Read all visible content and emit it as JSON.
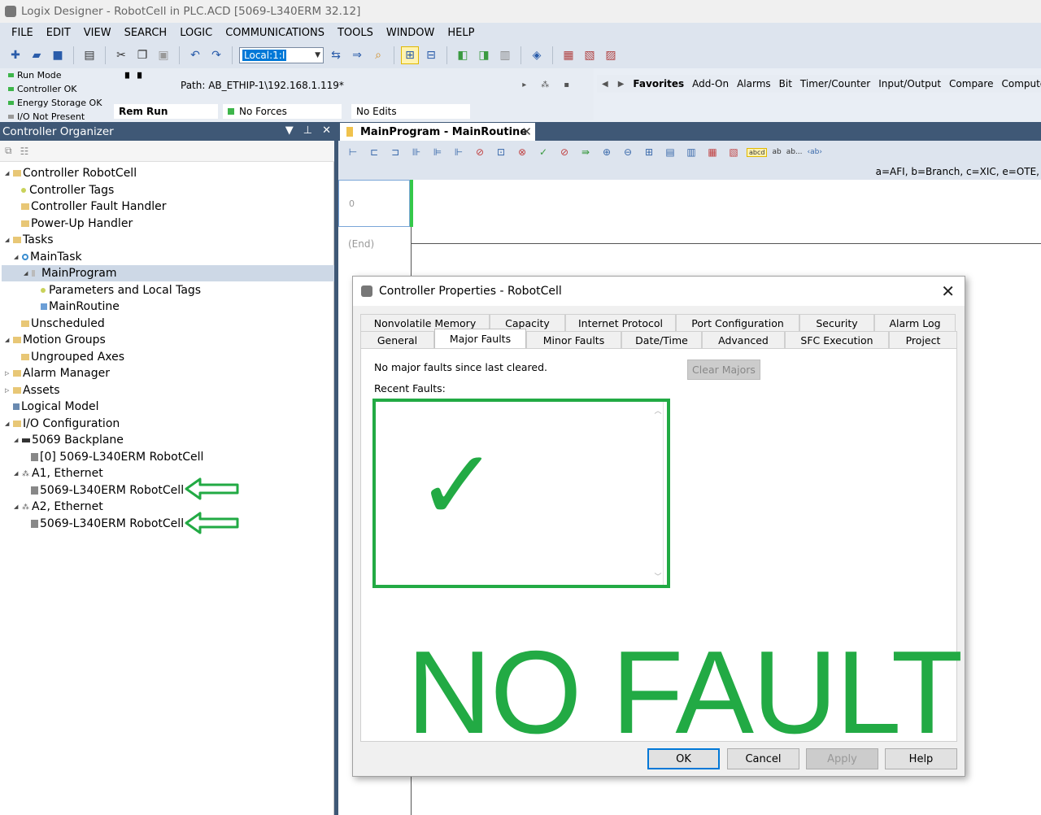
{
  "window": {
    "title": "Logix Designer - RobotCell in PLC.ACD [5069-L340ERM 32.12]"
  },
  "menu": [
    "FILE",
    "EDIT",
    "VIEW",
    "SEARCH",
    "LOGIC",
    "COMMUNICATIONS",
    "TOOLS",
    "WINDOW",
    "HELP"
  ],
  "toolbar": {
    "path_combo": "Local:1:I"
  },
  "status": {
    "lines": [
      "Run Mode",
      "Controller OK",
      "Energy Storage OK",
      "I/O Not Present"
    ],
    "path": "Path:  AB_ETHIP-1\\192.168.1.119*",
    "rem_run": "Rem Run",
    "no_forces": "No Forces",
    "no_edits": "No Edits"
  },
  "instruction_tabs": [
    "Favorites",
    "Add-On",
    "Alarms",
    "Bit",
    "Timer/Counter",
    "Input/Output",
    "Compare",
    "Compute/Math"
  ],
  "organizer": {
    "title": "Controller Organizer",
    "tree": [
      "Controller RobotCell",
      "Controller Tags",
      "Controller Fault Handler",
      "Power-Up Handler",
      "Tasks",
      "MainTask",
      "MainProgram",
      "Parameters and Local Tags",
      "MainRoutine",
      "Unscheduled",
      "Motion Groups",
      "Ungrouped Axes",
      "Alarm Manager",
      "Assets",
      "Logical Model",
      "I/O Configuration",
      "5069 Backplane",
      "[0] 5069-L340ERM RobotCell",
      "A1, Ethernet",
      "5069-L340ERM RobotCell",
      "A2, Ethernet",
      "5069-L340ERM RobotCell"
    ]
  },
  "editor": {
    "tab_title": "MainProgram - MainRoutine",
    "legend": "a=AFI, b=Branch, c=XIC, e=OTE,",
    "rung_number": "0",
    "end_label": "(End)",
    "toolbar_text": {
      "abcd": "abcd",
      "ab": "ab",
      "ab2": "ab...",
      "ab3": "‹ab›"
    }
  },
  "dialog": {
    "title": "Controller Properties - RobotCell",
    "tabs_row1": [
      "Nonvolatile Memory",
      "Capacity",
      "Internet Protocol",
      "Port Configuration",
      "Security",
      "Alarm Log"
    ],
    "tabs_row2": [
      "General",
      "Major Faults",
      "Minor Faults",
      "Date/Time",
      "Advanced",
      "SFC Execution",
      "Project"
    ],
    "active_tab": "Major Faults",
    "no_major_text": "No major faults since last cleared.",
    "clear_majors": "Clear Majors",
    "recent_faults_label": "Recent Faults:",
    "checkmark": "✓",
    "banner": "NO FAULT",
    "buttons": {
      "ok": "OK",
      "cancel": "Cancel",
      "apply": "Apply",
      "help": "Help"
    }
  },
  "colors": {
    "accent_green": "#22aa44",
    "header_blue": "#3f5876"
  }
}
